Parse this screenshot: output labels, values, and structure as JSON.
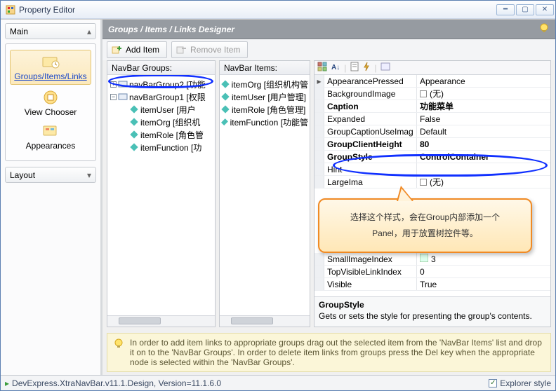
{
  "window": {
    "title": "Property Editor"
  },
  "sidebar": {
    "main_label": "Main",
    "items": [
      {
        "label": "Groups/Items/Links"
      },
      {
        "label": "View Chooser"
      },
      {
        "label": "Appearances"
      }
    ],
    "layout_label": "Layout"
  },
  "header": {
    "title": "Groups / Items / Links Designer"
  },
  "toolbar": {
    "add_item": "Add Item",
    "remove_item": "Remove Item"
  },
  "groups_panel": {
    "title": "NavBar Groups:",
    "nodes": [
      {
        "label": "navBarGroup2 [功能",
        "type": "group",
        "expanded": false
      },
      {
        "label": "navBarGroup1 [权限",
        "type": "group",
        "expanded": true,
        "children": [
          {
            "label": "itemUser [用户"
          },
          {
            "label": "itemOrg [组织机"
          },
          {
            "label": "itemRole [角色管"
          },
          {
            "label": "itemFunction [功"
          }
        ]
      }
    ]
  },
  "items_panel": {
    "title": "NavBar Items:",
    "items": [
      {
        "label": "itemOrg [组织机构管"
      },
      {
        "label": "itemUser [用户管理]"
      },
      {
        "label": "itemRole [角色管理]"
      },
      {
        "label": "itemFunction [功能管"
      }
    ]
  },
  "property_grid": {
    "rows": [
      {
        "k": "AppearancePressed",
        "v": "Appearance",
        "exp": "▸"
      },
      {
        "k": "BackgroundImage",
        "v": "(无)",
        "swatch": true
      },
      {
        "k": "Caption",
        "v": "功能菜单",
        "bold": true
      },
      {
        "k": "Expanded",
        "v": "False"
      },
      {
        "k": "GroupCaptionUseImag",
        "v": "Default"
      },
      {
        "k": "GroupClientHeight",
        "v": "80",
        "bold": true
      },
      {
        "k": "GroupStyle",
        "v": "ControlContainer",
        "bold": true,
        "highlight_row": true
      },
      {
        "k": "Hint",
        "v": ""
      },
      {
        "k": "LargeIma",
        "v": "(无)",
        "swatch": true
      },
      {
        "k": "SmallImageIndex",
        "v": "3",
        "icon": true
      },
      {
        "k": "TopVisibleLinkIndex",
        "v": "0"
      },
      {
        "k": "Visible",
        "v": "True"
      }
    ],
    "desc_title": "GroupStyle",
    "desc_body": "Gets or sets the style for presenting the group's contents."
  },
  "callout": {
    "line1": "选择这个样式，会在Group内部添加一个",
    "line2": "Panel，用于放置树控件等。"
  },
  "tip": "In order to add item links to appropriate groups drag out the selected item from the 'NavBar Items' list and drop it on to the 'NavBar Groups'. In order to delete item links from groups press the Del key when the appropriate node is selected within the 'NavBar Groups'.",
  "statusbar": {
    "left": "DevExpress.XtraNavBar.v11.1.Design, Version=11.1.6.0",
    "right": "Explorer style"
  }
}
